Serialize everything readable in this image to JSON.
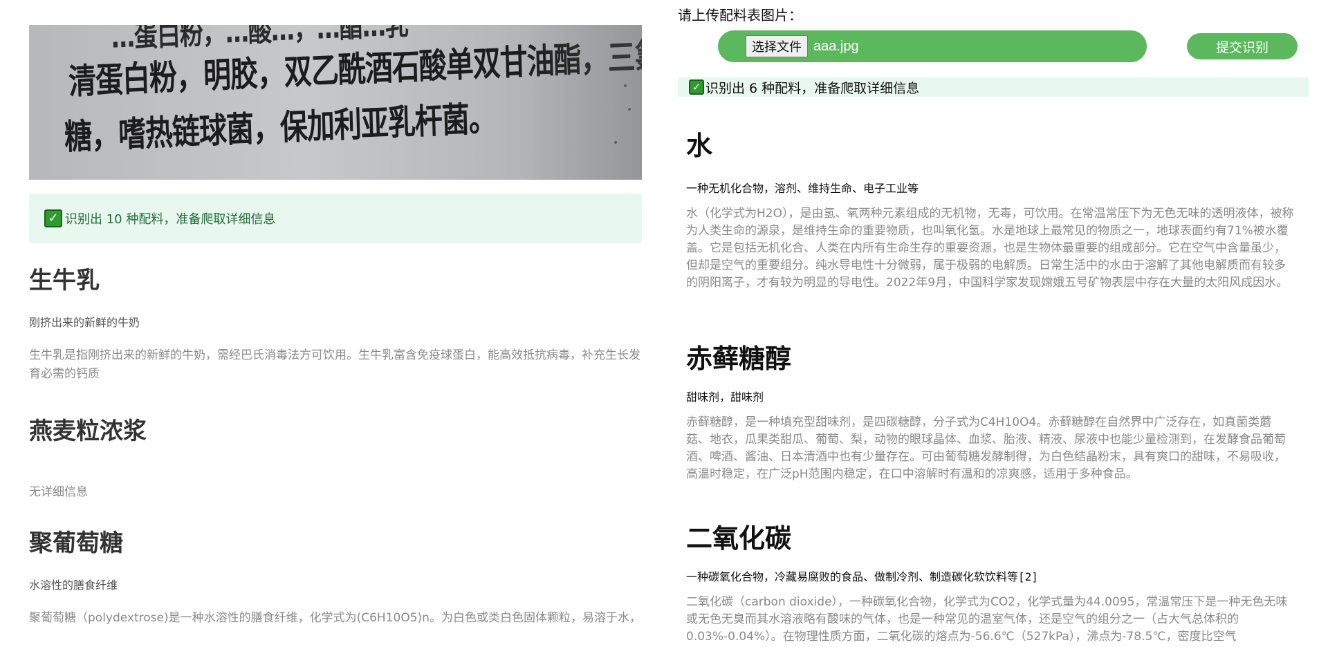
{
  "left_panel": {
    "photo_text": {
      "line0": "…蛋白粉，…酸…，…酯…乳",
      "line1": "清蛋白粉，明胶，双乙酰酒石酸单双甘油酯，三氯蔗",
      "line2": "糖，嗜热链球菌，保加利亚乳杆菌。"
    },
    "alert": "识别出 10 种配料，准备爬取详细信息",
    "ingredients": [
      {
        "name": "生牛乳",
        "subtitle": "刚挤出来的新鲜的牛奶",
        "description": "生牛乳是指刚挤出来的新鲜的牛奶，需经巴氏消毒法方可饮用。生牛乳富含免疫球蛋白，能高效抵抗病毒，补充生长发育必需的钙质"
      },
      {
        "name": "燕麦粒浓浆",
        "subtitle": "",
        "description": "无详细信息"
      },
      {
        "name": "聚葡萄糖",
        "subtitle": "水溶性的膳食纤维",
        "description": "聚葡萄糖（polydextrose)是一种水溶性的膳食纤维，化学式为(C6H10O5)n。为白色或类白色固体颗粒，易溶于水，"
      }
    ]
  },
  "right_panel": {
    "upload_label": "请上传配料表图片：",
    "file_button": "选择文件",
    "file_name": "aaa.jpg",
    "submit_button": "提交识别",
    "alert": "识别出 6 种配料，准备爬取详细信息",
    "ingredients": [
      {
        "name": "水",
        "subtitle": "一种无机化合物，溶剂、维持生命、电子工业等",
        "description": "水（化学式为H2O），是由氢、氧两种元素组成的无机物，无毒，可饮用。在常温常压下为无色无味的透明液体，被称为人类生命的源泉，是维持生命的重要物质，也叫氧化氢。水是地球上最常见的物质之一，地球表面约有71%被水覆盖。它是包括无机化合、人类在内所有生命生存的重要资源，也是生物体最重要的组成部分。它在空气中含量虽少，但却是空气的重要组分。纯水导电性十分微弱，属于极弱的电解质。日常生活中的水由于溶解了其他电解质而有较多的阴阳离子，才有较为明显的导电性。2022年9月，中国科学家发现嫦娥五号矿物表层中存在大量的太阳风成因水。"
      },
      {
        "name": "赤藓糖醇",
        "subtitle": "甜味剂，甜味剂",
        "description": "赤藓糖醇，是一种填充型甜味剂，是四碳糖醇，分子式为C4H10O4。赤藓糖醇在自然界中广泛存在，如真菌类蘑菇、地衣，瓜果类甜瓜、葡萄、梨，动物的眼球晶体、血浆、胎液、精液、尿液中也能少量检测到，在发酵食品葡萄酒、啤酒、酱油、日本清酒中也有少量存在。可由葡萄糖发酵制得，为白色结晶粉末，具有爽口的甜味，不易吸收，高温时稳定，在广泛pH范围内稳定，在口中溶解时有温和的凉爽感，适用于多种食品。"
      },
      {
        "name": "二氧化碳",
        "subtitle": "一种碳氧化合物，冷藏易腐败的食品、做制冷剂、制造碳化软饮料等[2]",
        "description": "二氧化碳（carbon dioxide），一种碳氧化合物，化学式为CO2，化学式量为44.0095，常温常压下是一种无色无味或无色无臭而其水溶液略有酸味的气体，也是一种常见的温室气体，还是空气的组分之一（占大气总体积的0.03%-0.04%）。在物理性质方面，二氧化碳的熔点为-56.6℃（527kPa），沸点为-78.5℃，密度比空气"
      }
    ]
  },
  "colors": {
    "accent_green": "#5cb85c",
    "alert_bg": "#e9f8ee",
    "check_green": "#2f9b2f"
  },
  "icons": {
    "alert_check": "check-mark-icon"
  }
}
